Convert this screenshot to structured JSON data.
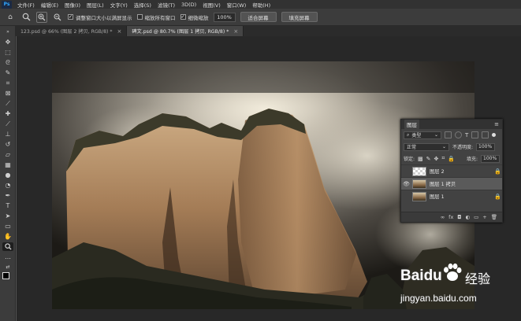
{
  "menubar": {
    "logo": "Ps",
    "items": [
      "文件(F)",
      "编辑(E)",
      "图像(I)",
      "图层(L)",
      "文字(Y)",
      "选择(S)",
      "滤镜(T)",
      "3D(D)",
      "视图(V)",
      "窗口(W)",
      "帮助(H)"
    ]
  },
  "options": {
    "resize_windows_label": "调整窗口大小以满屏显示",
    "zoom_all_label": "缩放所有窗口",
    "scrubby_zoom_label": "细微缩放",
    "zoom_value": "100%",
    "fit_screen_label": "适合屏幕",
    "fill_screen_label": "填充屏幕"
  },
  "tabs": [
    {
      "label": "123.psd @ 66% (图层 2 拷贝, RGB/8) *",
      "close": "×"
    },
    {
      "label": "碑文.psd @ 80.7% (图层 1 拷贝, RGB/8) *",
      "close": "×"
    }
  ],
  "layers_panel": {
    "title": "图层",
    "filter_label": "类型",
    "blend_mode": "正常",
    "opacity_label": "不透明度:",
    "opacity_value": "100%",
    "lock_label": "锁定:",
    "fill_label": "填充:",
    "fill_value": "100%",
    "layers": [
      {
        "name": "图层 2",
        "visible": false,
        "selected": false,
        "locked": true,
        "thumb": "checker"
      },
      {
        "name": "图层 1 拷贝",
        "visible": true,
        "selected": true,
        "locked": false,
        "thumb": "photo"
      },
      {
        "name": "图层 1",
        "visible": false,
        "selected": false,
        "locked": true,
        "thumb": "photo"
      }
    ],
    "footer_icons": [
      "∞",
      "fx",
      "◘",
      "◐",
      "▭",
      "+",
      "🗑"
    ]
  },
  "watermark": {
    "brand": "Baidu",
    "suffix": "经验",
    "url": "jingyan.baidu.com"
  }
}
